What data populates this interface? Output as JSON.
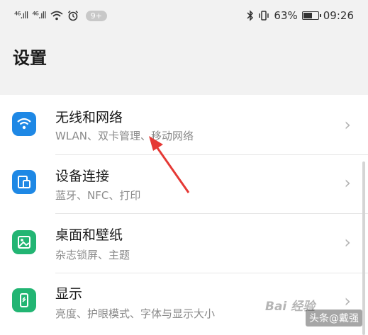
{
  "status_bar": {
    "signal_1": "⁴⁶.ıll",
    "signal_2": "⁴⁶.ıll",
    "notifications_badge": "9+",
    "battery_percent": "63%",
    "battery_level": 0.63,
    "time": "09:26"
  },
  "page": {
    "title": "设置"
  },
  "settings_items": [
    {
      "title": "无线和网络",
      "subtitle": "WLAN、双卡管理、移动网络",
      "icon": "wifi-icon",
      "color": "#1e88e5"
    },
    {
      "title": "设备连接",
      "subtitle": "蓝牙、NFC、打印",
      "icon": "device-connection-icon",
      "color": "#1e88e5"
    },
    {
      "title": "桌面和壁纸",
      "subtitle": "杂志锁屏、主题",
      "icon": "wallpaper-icon",
      "color": "#22b573"
    },
    {
      "title": "显示",
      "subtitle": "亮度、护眼模式、字体与显示大小",
      "icon": "display-icon",
      "color": "#22b573"
    }
  ],
  "overlay": {
    "watermark": "Bai 经验",
    "attribution": "头条@戴强"
  },
  "colors": {
    "accent_blue": "#1e88e5",
    "accent_green": "#22b573",
    "annotation_red": "#e53935"
  }
}
